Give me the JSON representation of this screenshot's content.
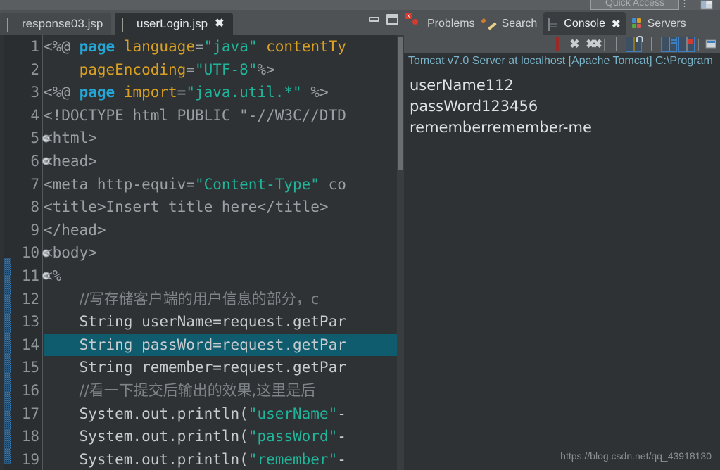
{
  "window": {
    "quick_access_label": "Quick Access",
    "minimize_label": "Minimize",
    "maximize_label": "Maximize"
  },
  "editor": {
    "tabs": [
      {
        "label": "response03.jsp",
        "active": false,
        "icon": "jsp-file-icon",
        "closable": false
      },
      {
        "label": "userLogin.jsp",
        "active": true,
        "icon": "jsp-file-icon",
        "closable": true
      }
    ],
    "close_glyph": "✖",
    "lines": [
      {
        "n": "1",
        "fold": false,
        "modified": false,
        "highlight": false,
        "tokens": [
          {
            "t": "<%@ ",
            "c": "k-tag"
          },
          {
            "t": "page",
            "c": "k-kw"
          },
          {
            "t": " ",
            "c": "k-txt"
          },
          {
            "t": "language",
            "c": "k-attr"
          },
          {
            "t": "=",
            "c": "k-tag"
          },
          {
            "t": "\"java\"",
            "c": "k-str"
          },
          {
            "t": " ",
            "c": "k-txt"
          },
          {
            "t": "contentTy",
            "c": "k-attr"
          }
        ]
      },
      {
        "n": "2",
        "fold": false,
        "modified": false,
        "highlight": false,
        "tokens": [
          {
            "t": "    ",
            "c": "k-txt"
          },
          {
            "t": "pageEncoding",
            "c": "k-attr"
          },
          {
            "t": "=",
            "c": "k-tag"
          },
          {
            "t": "\"UTF-8\"",
            "c": "k-str"
          },
          {
            "t": "%>",
            "c": "k-tag"
          }
        ]
      },
      {
        "n": "3",
        "fold": false,
        "modified": false,
        "highlight": false,
        "tokens": [
          {
            "t": "<%@ ",
            "c": "k-tag"
          },
          {
            "t": "page",
            "c": "k-kw"
          },
          {
            "t": " ",
            "c": "k-txt"
          },
          {
            "t": "import",
            "c": "k-attr"
          },
          {
            "t": "=",
            "c": "k-tag"
          },
          {
            "t": "\"java.util.*\"",
            "c": "k-str"
          },
          {
            "t": " %>",
            "c": "k-tag"
          }
        ]
      },
      {
        "n": "4",
        "fold": false,
        "modified": false,
        "highlight": false,
        "tokens": [
          {
            "t": "<!DOCTYPE html PUBLIC \"-//W3C//DTD",
            "c": "k-tag"
          }
        ]
      },
      {
        "n": "5",
        "fold": true,
        "modified": false,
        "highlight": false,
        "tokens": [
          {
            "t": "<html>",
            "c": "k-tag"
          }
        ]
      },
      {
        "n": "6",
        "fold": true,
        "modified": false,
        "highlight": false,
        "tokens": [
          {
            "t": "<head>",
            "c": "k-tag"
          }
        ]
      },
      {
        "n": "7",
        "fold": false,
        "modified": false,
        "highlight": false,
        "tokens": [
          {
            "t": "<meta http-equiv=",
            "c": "k-tag"
          },
          {
            "t": "\"Content-Type\"",
            "c": "k-str"
          },
          {
            "t": " co",
            "c": "k-tag"
          }
        ]
      },
      {
        "n": "8",
        "fold": false,
        "modified": false,
        "highlight": false,
        "tokens": [
          {
            "t": "<title>Insert title here</title>",
            "c": "k-tag"
          }
        ]
      },
      {
        "n": "9",
        "fold": false,
        "modified": false,
        "highlight": false,
        "tokens": [
          {
            "t": "</head>",
            "c": "k-tag"
          }
        ]
      },
      {
        "n": "10",
        "fold": true,
        "modified": false,
        "highlight": false,
        "tokens": [
          {
            "t": "<body>",
            "c": "k-tag"
          }
        ]
      },
      {
        "n": "11",
        "fold": true,
        "modified": true,
        "highlight": false,
        "tokens": [
          {
            "t": "<%",
            "c": "k-tag"
          }
        ]
      },
      {
        "n": "12",
        "fold": false,
        "modified": true,
        "highlight": false,
        "tokens": [
          {
            "t": "    ",
            "c": "k-txt"
          },
          {
            "t": "//写存储客户端的用户信息的部分，c",
            "c": "k-com k-cjk"
          }
        ]
      },
      {
        "n": "13",
        "fold": false,
        "modified": true,
        "highlight": false,
        "tokens": [
          {
            "t": "    String userName=request.getPar",
            "c": "k-txt"
          }
        ]
      },
      {
        "n": "14",
        "fold": false,
        "modified": true,
        "highlight": true,
        "tokens": [
          {
            "t": "    String passWord=request.getPar",
            "c": "k-txt"
          }
        ]
      },
      {
        "n": "15",
        "fold": false,
        "modified": true,
        "highlight": false,
        "tokens": [
          {
            "t": "    String remember=request.getPar",
            "c": "k-txt"
          }
        ]
      },
      {
        "n": "16",
        "fold": false,
        "modified": true,
        "highlight": false,
        "tokens": [
          {
            "t": "    ",
            "c": "k-txt"
          },
          {
            "t": "//看一下提交后输出的效果,这里是后",
            "c": "k-com k-cjk"
          }
        ]
      },
      {
        "n": "17",
        "fold": false,
        "modified": true,
        "highlight": false,
        "tokens": [
          {
            "t": "    System.out.println(",
            "c": "k-txt"
          },
          {
            "t": "\"userName\"",
            "c": "k-str"
          },
          {
            "t": "-",
            "c": "k-txt"
          }
        ]
      },
      {
        "n": "18",
        "fold": false,
        "modified": true,
        "highlight": false,
        "tokens": [
          {
            "t": "    System.out.println(",
            "c": "k-txt"
          },
          {
            "t": "\"passWord\"",
            "c": "k-str"
          },
          {
            "t": "-",
            "c": "k-txt"
          }
        ]
      },
      {
        "n": "19",
        "fold": false,
        "modified": true,
        "highlight": false,
        "tokens": [
          {
            "t": "    System.out.println(",
            "c": "k-txt"
          },
          {
            "t": "\"remember\"",
            "c": "k-str"
          },
          {
            "t": "-",
            "c": "k-txt"
          }
        ]
      }
    ]
  },
  "views": {
    "tabs": [
      {
        "label": "Problems",
        "icon": "problems-icon",
        "active": false,
        "closable": false
      },
      {
        "label": "Search",
        "icon": "search-icon",
        "active": false,
        "closable": false
      },
      {
        "label": "Console",
        "icon": "console-icon",
        "active": true,
        "closable": true
      },
      {
        "label": "Servers",
        "icon": "servers-icon",
        "active": false,
        "closable": false
      }
    ],
    "close_glyph": "✖"
  },
  "console": {
    "toolbar": [
      {
        "name": "terminate-button",
        "icon": "stop-icon",
        "toggled": false
      },
      {
        "name": "remove-launch-button",
        "icon": "remove-icon",
        "toggled": false
      },
      {
        "name": "remove-all-terminated-button",
        "icon": "remove-all-icon",
        "toggled": false
      },
      {
        "name": "clear-console-button",
        "icon": "clear-console-icon",
        "toggled": false
      },
      {
        "name": "scroll-lock-button",
        "icon": "scroll-lock-icon",
        "toggled": true
      },
      {
        "name": "word-wrap-button",
        "icon": "word-wrap-icon",
        "toggled": false
      },
      {
        "name": "pin-console-button",
        "icon": "pin-console-icon",
        "toggled": true
      },
      {
        "name": "display-selected-console-button",
        "icon": "display-console-icon",
        "toggled": true
      }
    ],
    "header": "Tomcat v7.0 Server at localhost [Apache Tomcat] C:\\Program",
    "output": "userName112\npassWord123456\nrememberremember-me",
    "output_lines": [
      "userName112",
      "passWord123456",
      "rememberremember-me"
    ]
  },
  "watermark": "https://blog.csdn.net/qq_43918130",
  "colors": {
    "editor_bg": "#2f3234",
    "panel_bg": "#4e5254",
    "active_tab_bg": "#2f3234",
    "current_line": "#0f5c6e",
    "keyword": "#24a7d6",
    "attribute": "#d9a022",
    "string": "#20b49a",
    "tag": "#9aa0a3",
    "comment": "#7e8487",
    "console_header": "#79b4c9",
    "console_text": "#dfe2e4",
    "change_bar": "#2a7fc6",
    "toggle_border": "#3f7fbf"
  }
}
